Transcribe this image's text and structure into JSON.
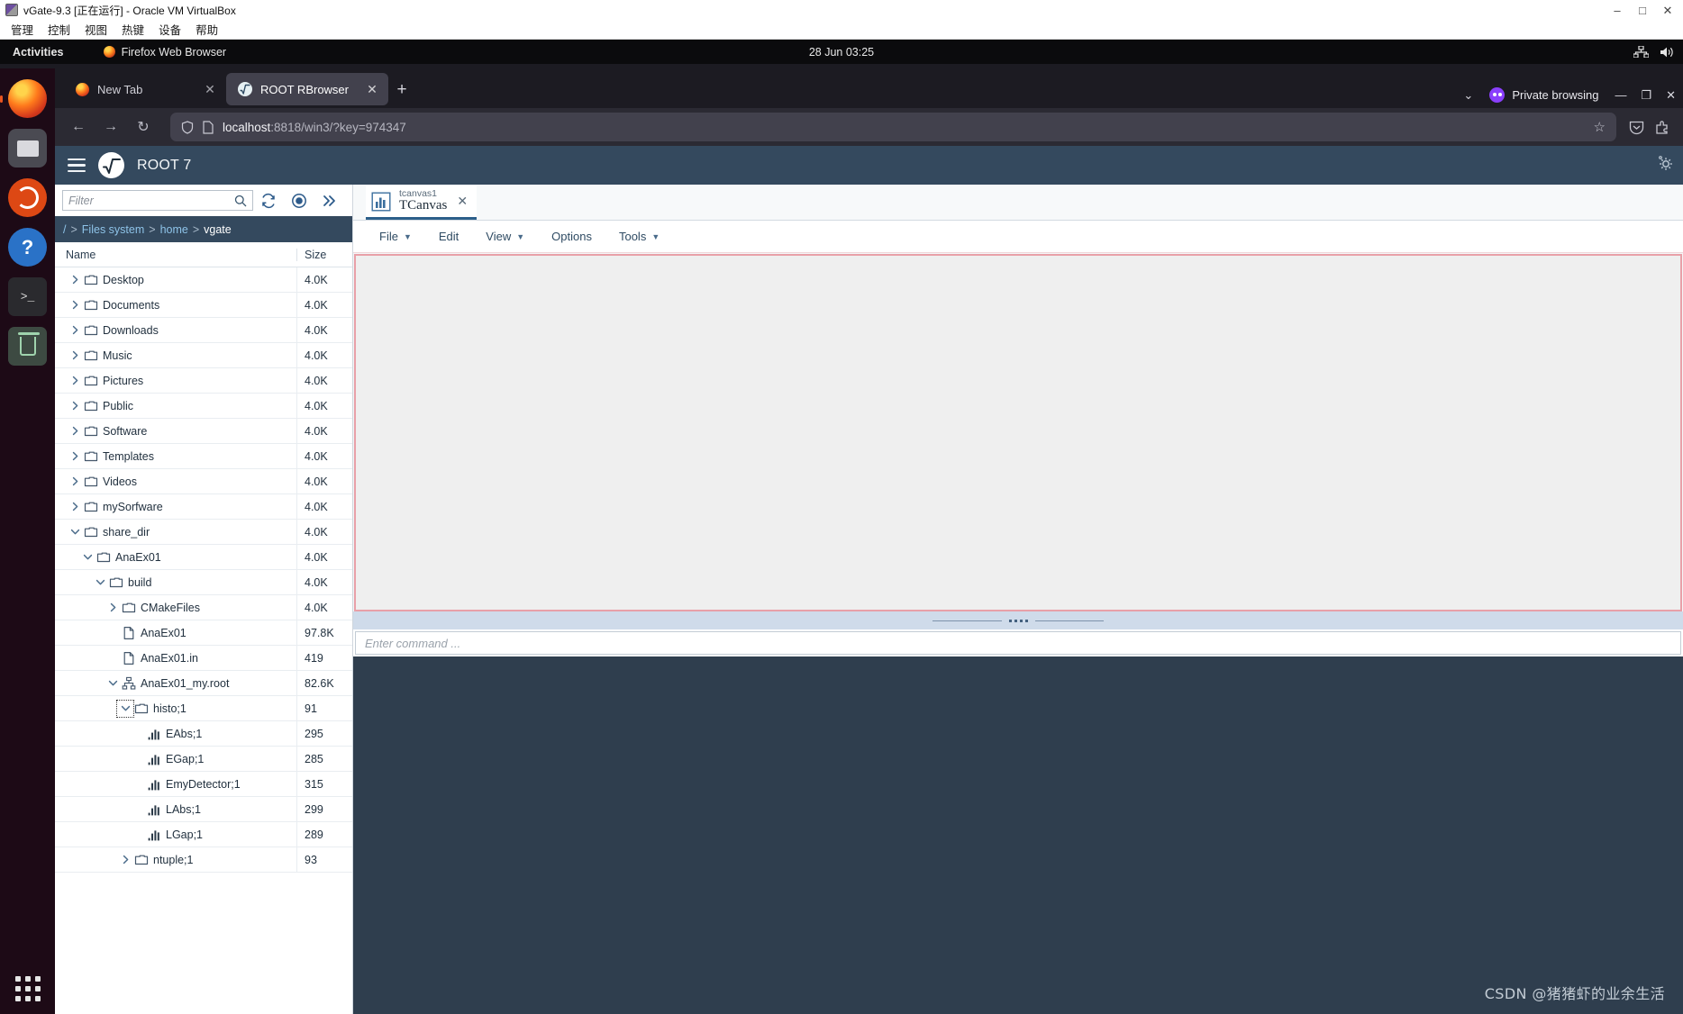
{
  "vbox": {
    "title": "vGate-9.3 [正在运行] - Oracle VM VirtualBox",
    "menu": [
      "管理",
      "控制",
      "视图",
      "热键",
      "设备",
      "帮助"
    ],
    "window_buttons": [
      "–",
      "□",
      "✕"
    ]
  },
  "gnome": {
    "activities": "Activities",
    "app_name": "Firefox Web Browser",
    "clock": "28 Jun  03:25"
  },
  "firefox": {
    "tabs": [
      {
        "title": "New Tab",
        "favicon": "firefox-icon",
        "active": false,
        "close": "✕"
      },
      {
        "title": "ROOT RBrowser",
        "favicon": "root-icon",
        "active": true,
        "close": "✕"
      }
    ],
    "new_tab_label": "+",
    "tab_list_caret": "⌄",
    "private_browsing_label": "Private browsing",
    "window_controls": [
      "—",
      "❐",
      "✕"
    ],
    "nav": {
      "back": "←",
      "forward": "→",
      "reload": "↻"
    },
    "url": {
      "host": "localhost",
      "rest": ":8818/win3/?key=974347",
      "full": "localhost:8818/win3/?key=974347"
    },
    "bookmark_star": "☆"
  },
  "root": {
    "header": {
      "title": "ROOT 7"
    },
    "left_panel": {
      "filter_placeholder": "Filter",
      "toolbar_icons": [
        "search-icon",
        "refresh-icon",
        "record-icon",
        "expand-icon"
      ],
      "breadcrumb": [
        {
          "label": "/",
          "current": false
        },
        {
          "label": "Files system",
          "current": false
        },
        {
          "label": "home",
          "current": false
        },
        {
          "label": "vgate",
          "current": true
        }
      ],
      "columns": [
        "Name",
        "Size"
      ],
      "rows": [
        {
          "name": "Desktop",
          "size": "4.0K",
          "indent": 0,
          "icon": "folder-icon",
          "chevron": "right"
        },
        {
          "name": "Documents",
          "size": "4.0K",
          "indent": 0,
          "icon": "folder-icon",
          "chevron": "right"
        },
        {
          "name": "Downloads",
          "size": "4.0K",
          "indent": 0,
          "icon": "folder-icon",
          "chevron": "right"
        },
        {
          "name": "Music",
          "size": "4.0K",
          "indent": 0,
          "icon": "folder-icon",
          "chevron": "right"
        },
        {
          "name": "Pictures",
          "size": "4.0K",
          "indent": 0,
          "icon": "folder-icon",
          "chevron": "right"
        },
        {
          "name": "Public",
          "size": "4.0K",
          "indent": 0,
          "icon": "folder-icon",
          "chevron": "right"
        },
        {
          "name": "Software",
          "size": "4.0K",
          "indent": 0,
          "icon": "folder-icon",
          "chevron": "right"
        },
        {
          "name": "Templates",
          "size": "4.0K",
          "indent": 0,
          "icon": "folder-icon",
          "chevron": "right"
        },
        {
          "name": "Videos",
          "size": "4.0K",
          "indent": 0,
          "icon": "folder-icon",
          "chevron": "right"
        },
        {
          "name": "mySorfware",
          "size": "4.0K",
          "indent": 0,
          "icon": "folder-icon",
          "chevron": "right"
        },
        {
          "name": "share_dir",
          "size": "4.0K",
          "indent": 0,
          "icon": "folder-icon",
          "chevron": "down"
        },
        {
          "name": "AnaEx01",
          "size": "4.0K",
          "indent": 1,
          "icon": "folder-icon",
          "chevron": "down"
        },
        {
          "name": "build",
          "size": "4.0K",
          "indent": 2,
          "icon": "folder-icon",
          "chevron": "down"
        },
        {
          "name": "CMakeFiles",
          "size": "4.0K",
          "indent": 3,
          "icon": "folder-icon",
          "chevron": "right"
        },
        {
          "name": "AnaEx01",
          "size": "97.8K",
          "indent": 3,
          "icon": "file-icon",
          "chevron": "none"
        },
        {
          "name": "AnaEx01.in",
          "size": "419",
          "indent": 3,
          "icon": "file-icon",
          "chevron": "none"
        },
        {
          "name": "AnaEx01_my.root",
          "size": "82.6K",
          "indent": 3,
          "icon": "tree-icon",
          "chevron": "down"
        },
        {
          "name": "histo;1",
          "size": "91",
          "indent": 4,
          "icon": "folder-icon",
          "chevron": "down",
          "focused": true
        },
        {
          "name": "EAbs;1",
          "size": "295",
          "indent": 5,
          "icon": "histogram-icon",
          "chevron": "none"
        },
        {
          "name": "EGap;1",
          "size": "285",
          "indent": 5,
          "icon": "histogram-icon",
          "chevron": "none"
        },
        {
          "name": "EmyDetector;1",
          "size": "315",
          "indent": 5,
          "icon": "histogram-icon",
          "chevron": "none"
        },
        {
          "name": "LAbs;1",
          "size": "299",
          "indent": 5,
          "icon": "histogram-icon",
          "chevron": "none"
        },
        {
          "name": "LGap;1",
          "size": "289",
          "indent": 5,
          "icon": "histogram-icon",
          "chevron": "none"
        },
        {
          "name": "ntuple;1",
          "size": "93",
          "indent": 4,
          "icon": "folder-icon",
          "chevron": "right"
        }
      ]
    },
    "right_panel": {
      "tab": {
        "subtitle": "tcanvas1",
        "title": "TCanvas",
        "icon": "histogram-icon",
        "close": "✕"
      },
      "menu": [
        {
          "label": "File",
          "caret": true
        },
        {
          "label": "Edit",
          "caret": false
        },
        {
          "label": "View",
          "caret": true
        },
        {
          "label": "Options",
          "caret": false
        },
        {
          "label": "Tools",
          "caret": true
        }
      ],
      "command_placeholder": "Enter command ...",
      "command_value": ""
    },
    "colors": {
      "header_bg": "#34495e",
      "canvas_border": "#e8a0a8",
      "canvas_bg": "#efefef",
      "console_bg": "#2f3e4e",
      "accent": "#2c5f8a"
    }
  },
  "watermark": "CSDN @猪猪虾的业余生活"
}
